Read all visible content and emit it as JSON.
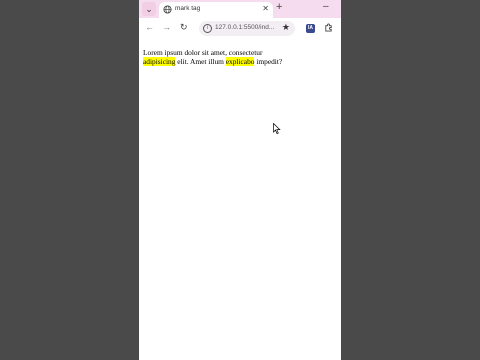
{
  "tab": {
    "title": "mark tag",
    "list_icon": "chevron-down-icon",
    "close_icon": "close-icon",
    "new_tab_icon": "plus-icon",
    "minimize_icon": "minimize-icon"
  },
  "toolbar": {
    "back_icon": "arrow-left-icon",
    "forward_icon": "arrow-right-icon",
    "reload_icon": "reload-icon",
    "url": "127.0.0.1:5500/ind...",
    "bookmark_icon": "star-icon",
    "extension_label": "IA",
    "extensions_icon": "puzzle-icon"
  },
  "page": {
    "text_1": "Lorem ipsum dolor sit amet, consectetur",
    "mark_1": "adipisicing",
    "text_2": " elit. Amet illum ",
    "mark_2": "explicabo",
    "text_3": " impedit?"
  },
  "colors": {
    "tabstrip_bg": "#f6dcef",
    "mark_highlight": "#ffff00",
    "outer_bg": "#4a4a4a"
  }
}
